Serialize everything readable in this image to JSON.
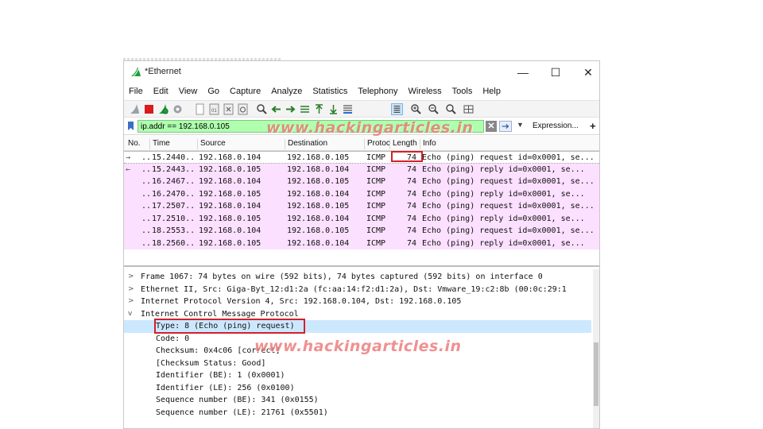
{
  "window": {
    "title": "*Ethernet",
    "min_glyph": "—",
    "max_glyph": "☐",
    "close_glyph": "✕"
  },
  "menu": [
    "File",
    "Edit",
    "View",
    "Go",
    "Capture",
    "Analyze",
    "Statistics",
    "Telephony",
    "Wireless",
    "Tools",
    "Help"
  ],
  "filter": {
    "value": "ip.addr == 192.168.0.105",
    "clear_glyph": "✕",
    "dropdown_glyph": "▼",
    "expression_label": "Expression...",
    "plus_label": "+"
  },
  "columns": {
    "no": "No.",
    "time": "Time",
    "source": "Source",
    "destination": "Destination",
    "protocol": "Protocol",
    "length": "Length",
    "info": "Info"
  },
  "packets": [
    {
      "arrow": "→",
      "dots": "..",
      "time": "15.2440...",
      "source": "192.168.0.104",
      "destination": "192.168.0.105",
      "protocol": "ICMP",
      "length": "74",
      "info": "Echo (ping) request  id=0x0001, se..."
    },
    {
      "arrow": "←",
      "dots": "..",
      "time": "15.2443...",
      "source": "192.168.0.105",
      "destination": "192.168.0.104",
      "protocol": "ICMP",
      "length": "74",
      "info": "Echo (ping) reply    id=0x0001, se..."
    },
    {
      "arrow": "",
      "dots": "..",
      "time": "16.2467...",
      "source": "192.168.0.104",
      "destination": "192.168.0.105",
      "protocol": "ICMP",
      "length": "74",
      "info": "Echo (ping) request  id=0x0001, se..."
    },
    {
      "arrow": "",
      "dots": "..",
      "time": "16.2470...",
      "source": "192.168.0.105",
      "destination": "192.168.0.104",
      "protocol": "ICMP",
      "length": "74",
      "info": "Echo (ping) reply    id=0x0001, se..."
    },
    {
      "arrow": "",
      "dots": "..",
      "time": "17.2507...",
      "source": "192.168.0.104",
      "destination": "192.168.0.105",
      "protocol": "ICMP",
      "length": "74",
      "info": "Echo (ping) request  id=0x0001, se..."
    },
    {
      "arrow": "",
      "dots": "..",
      "time": "17.2510...",
      "source": "192.168.0.105",
      "destination": "192.168.0.104",
      "protocol": "ICMP",
      "length": "74",
      "info": "Echo (ping) reply    id=0x0001, se..."
    },
    {
      "arrow": "",
      "dots": "..",
      "time": "18.2553...",
      "source": "192.168.0.104",
      "destination": "192.168.0.105",
      "protocol": "ICMP",
      "length": "74",
      "info": "Echo (ping) request  id=0x0001, se..."
    },
    {
      "arrow": "",
      "dots": "..",
      "time": "18.2560...",
      "source": "192.168.0.105",
      "destination": "192.168.0.104",
      "protocol": "ICMP",
      "length": "74",
      "info": "Echo (ping) reply    id=0x0001, se..."
    }
  ],
  "details": [
    {
      "arrow": ">",
      "indent": 0,
      "text": "Frame 1067: 74 bytes on wire (592 bits), 74 bytes captured (592 bits) on interface 0"
    },
    {
      "arrow": ">",
      "indent": 0,
      "text": "Ethernet II, Src: Giga-Byt_12:d1:2a (fc:aa:14:f2:d1:2a), Dst: Vmware_19:c2:8b (00:0c:29:1"
    },
    {
      "arrow": ">",
      "indent": 0,
      "text": "Internet Protocol Version 4, Src: 192.168.0.104, Dst: 192.168.0.105"
    },
    {
      "arrow": "v",
      "indent": 0,
      "text": "Internet Control Message Protocol"
    },
    {
      "arrow": "",
      "indent": 1,
      "text": "Type: 8 (Echo (ping) request)"
    },
    {
      "arrow": "",
      "indent": 1,
      "text": "Code: 0"
    },
    {
      "arrow": "",
      "indent": 1,
      "text": "Checksum: 0x4c06 [correct]"
    },
    {
      "arrow": "",
      "indent": 1,
      "text": "[Checksum Status: Good]"
    },
    {
      "arrow": "",
      "indent": 1,
      "text": "Identifier (BE): 1 (0x0001)"
    },
    {
      "arrow": "",
      "indent": 1,
      "text": "Identifier (LE): 256 (0x0100)"
    },
    {
      "arrow": "",
      "indent": 1,
      "text": "Sequence number (BE): 341 (0x0155)"
    },
    {
      "arrow": "",
      "indent": 1,
      "text": "Sequence number (LE): 21761 (0x5501)"
    }
  ],
  "watermark": "www.hackingarticles.in",
  "colors": {
    "filter_ok": "#afffaf",
    "icmp_row": "#fce0ff",
    "highlight": "#d0212a",
    "selected_detail": "#cce8ff"
  }
}
